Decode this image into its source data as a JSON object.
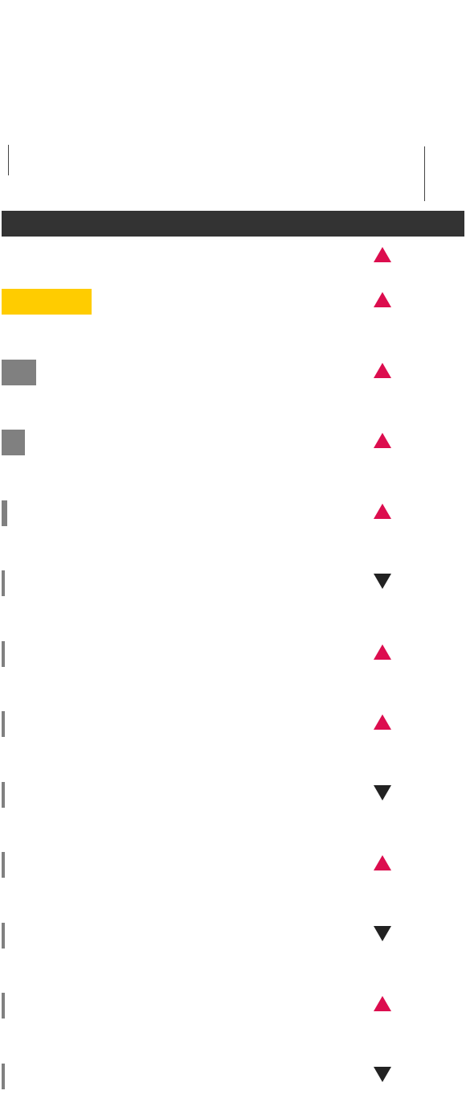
{
  "colors": {
    "header": "#333333",
    "highlight_bar": "#ffcc00",
    "neutral_bar": "#808080",
    "up_arrow": "#dc0d4e",
    "down_arrow": "#222222"
  },
  "rows": [
    {
      "bar_color": "none",
      "bar_fraction": 0.0,
      "direction": "up",
      "icon": "triangle-up-icon"
    },
    {
      "bar_color": "#ffcc00",
      "bar_fraction": 0.195,
      "direction": "up",
      "icon": "triangle-up-icon"
    },
    {
      "bar_color": "#808080",
      "bar_fraction": 0.074,
      "direction": "up",
      "icon": "triangle-up-icon"
    },
    {
      "bar_color": "#808080",
      "bar_fraction": 0.05,
      "direction": "up",
      "icon": "triangle-up-icon"
    },
    {
      "bar_color": "#808080",
      "bar_fraction": 0.012,
      "direction": "up",
      "icon": "triangle-up-icon"
    },
    {
      "bar_color": "#808080",
      "bar_fraction": 0.007,
      "direction": "down",
      "icon": "triangle-down-icon"
    },
    {
      "bar_color": "#808080",
      "bar_fraction": 0.007,
      "direction": "up",
      "icon": "triangle-up-icon"
    },
    {
      "bar_color": "#808080",
      "bar_fraction": 0.007,
      "direction": "up",
      "icon": "triangle-up-icon"
    },
    {
      "bar_color": "#808080",
      "bar_fraction": 0.007,
      "direction": "down",
      "icon": "triangle-down-icon"
    },
    {
      "bar_color": "#808080",
      "bar_fraction": 0.007,
      "direction": "up",
      "icon": "triangle-up-icon"
    },
    {
      "bar_color": "#808080",
      "bar_fraction": 0.007,
      "direction": "down",
      "icon": "triangle-down-icon"
    },
    {
      "bar_color": "#808080",
      "bar_fraction": 0.007,
      "direction": "up",
      "icon": "triangle-up-icon"
    },
    {
      "bar_color": "#808080",
      "bar_fraction": 0.007,
      "direction": "down",
      "icon": "triangle-down-icon"
    }
  ]
}
